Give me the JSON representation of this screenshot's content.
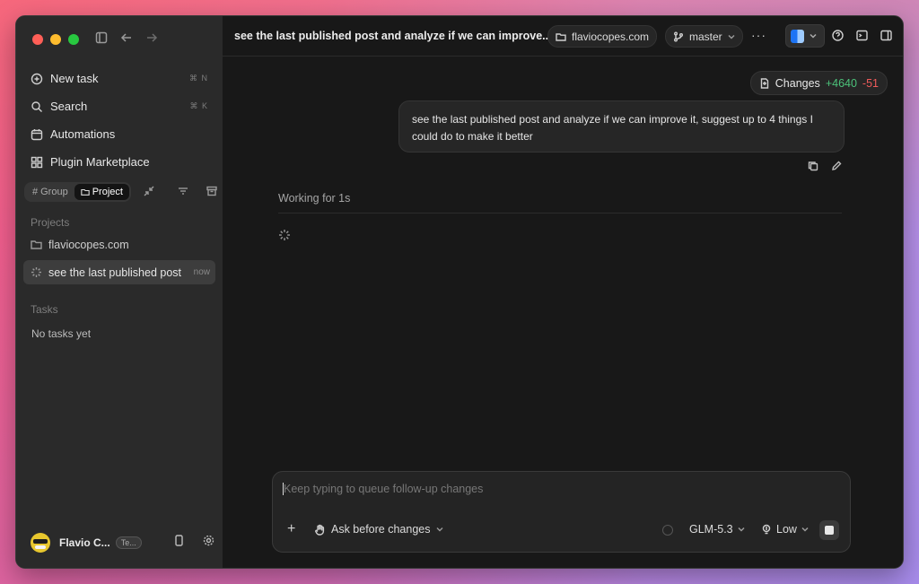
{
  "sidebar": {
    "nav": [
      {
        "label": "New task",
        "shortcut": "⌘ N",
        "icon": "new-task-icon"
      },
      {
        "label": "Search",
        "shortcut": "⌘ K",
        "icon": "search-icon"
      },
      {
        "label": "Automations",
        "shortcut": "",
        "icon": "automations-icon"
      },
      {
        "label": "Plugin Marketplace",
        "shortcut": "",
        "icon": "plugin-icon"
      }
    ],
    "group_toggle": {
      "group_label": "Group",
      "project_label": "Project",
      "selected": "Project"
    },
    "projects_title": "Projects",
    "projects": [
      {
        "label": "flaviocopes.com",
        "time": ""
      },
      {
        "label": "see the last published post",
        "time": "now"
      }
    ],
    "tasks_title": "Tasks",
    "tasks_empty": "No tasks yet",
    "profile": {
      "name": "Flavio C...",
      "tag": "Te..."
    }
  },
  "topbar": {
    "title": "see the last published post and analyze if we can improve...",
    "project": "flaviocopes.com",
    "branch": "master",
    "more": "···"
  },
  "changes": {
    "label": "Changes",
    "added": "+4640",
    "removed": "-51"
  },
  "message": {
    "text": "see the last published post and analyze if we can improve it, suggest up to 4 things I could do to make it better"
  },
  "status": {
    "working": "Working for 1s"
  },
  "composer": {
    "placeholder": "Keep typing to queue follow-up changes",
    "mode": "Ask before changes",
    "model": "GLM-5.3",
    "effort": "Low"
  },
  "colors": {
    "added": "#4cc27a",
    "removed": "#ef5a5a",
    "accent_blue": "#1d74f5"
  }
}
